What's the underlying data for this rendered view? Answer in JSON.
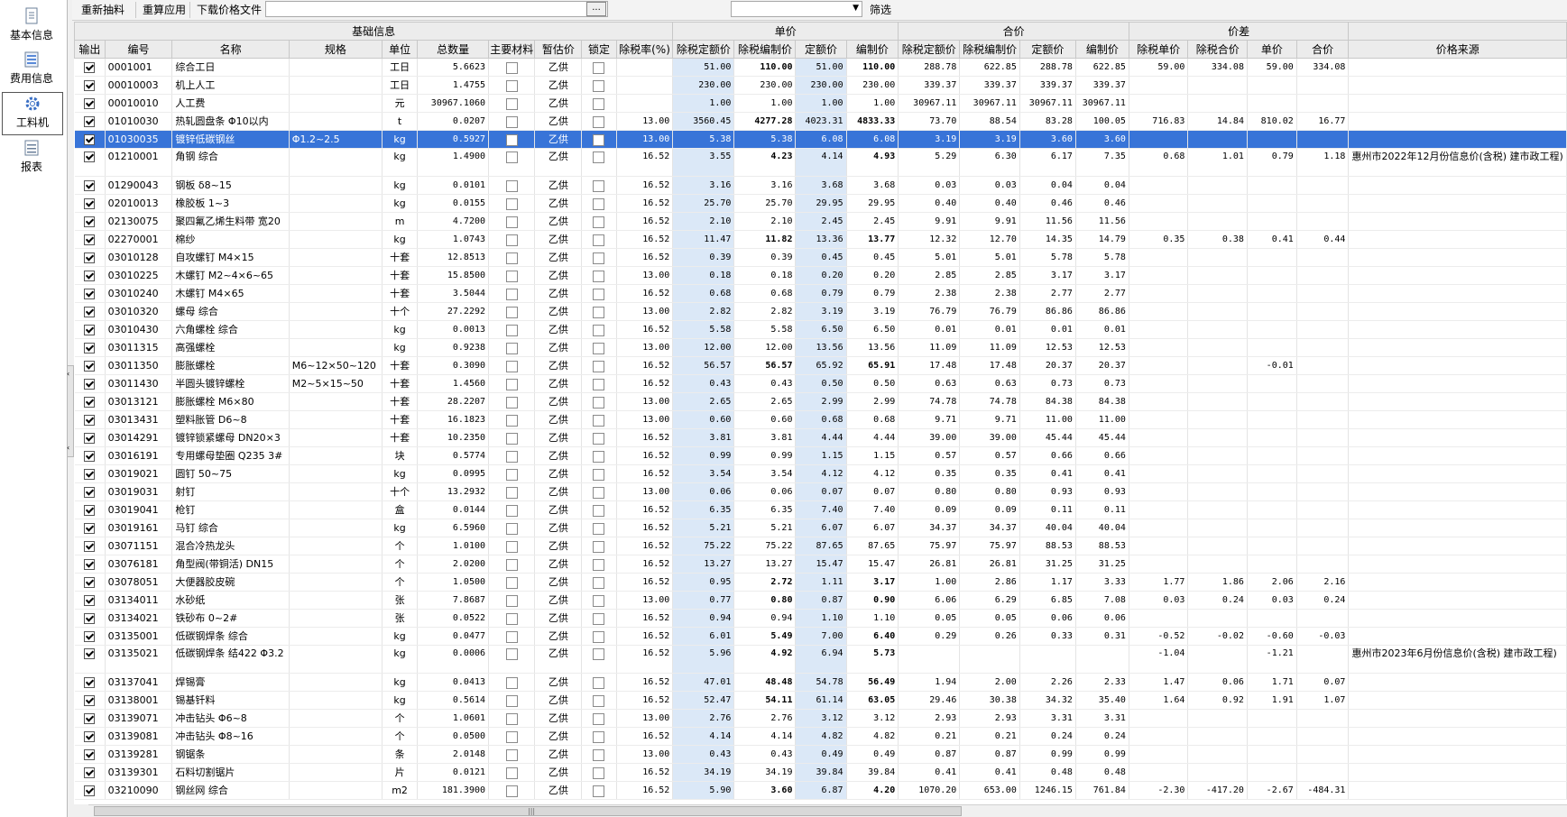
{
  "sidebar": {
    "items": [
      {
        "label": "基本信息",
        "icon": "document-icon"
      },
      {
        "label": "费用信息",
        "icon": "list-icon"
      },
      {
        "label": "工料机",
        "icon": "gear-icon"
      },
      {
        "label": "报表",
        "icon": "report-icon"
      }
    ],
    "active_index": 2
  },
  "toolbar": {
    "re_extract": "重新抽料",
    "re_apply": "重算应用",
    "download_price": "下载价格文件",
    "file_path": "",
    "browse": "...",
    "filter_value": "",
    "filter_label": "筛选"
  },
  "groups": [
    "基础信息",
    "单价",
    "合价",
    "价差"
  ],
  "columns": [
    "输出",
    "编号",
    "名称",
    "规格",
    "单位",
    "总数量",
    "主要材料",
    "暂估价",
    "锁定",
    "除税率(%)",
    "除税定额价",
    "除税编制价",
    "定额价",
    "编制价",
    "除税定额价",
    "除税编制价",
    "定额价",
    "编制价",
    "除税单价",
    "除税合价",
    "单价",
    "合价",
    "价格来源"
  ],
  "rows": [
    [
      "0001001",
      "综合工日",
      "",
      "工日",
      "5.6623",
      "乙供",
      "",
      "51.00",
      "110.00",
      "51.00",
      "110.00",
      "288.78",
      "622.85",
      "288.78",
      "622.85",
      "59.00",
      "334.08",
      "59.00",
      "334.08",
      ""
    ],
    [
      "00010003",
      "机上人工",
      "",
      "工日",
      "1.4755",
      "乙供",
      "",
      "230.00",
      "230.00",
      "230.00",
      "230.00",
      "339.37",
      "339.37",
      "339.37",
      "339.37",
      "",
      "",
      "",
      "",
      ""
    ],
    [
      "00010010",
      "人工费",
      "",
      "元",
      "30967.1060",
      "乙供",
      "",
      "1.00",
      "1.00",
      "1.00",
      "1.00",
      "30967.11",
      "30967.11",
      "30967.11",
      "30967.11",
      "",
      "",
      "",
      "",
      ""
    ],
    [
      "01010030",
      "热轧圆盘条 Φ10以内",
      "",
      "t",
      "0.0207",
      "乙供",
      "13.00",
      "3560.45",
      "4277.28",
      "4023.31",
      "4833.33",
      "73.70",
      "88.54",
      "83.28",
      "100.05",
      "716.83",
      "14.84",
      "810.02",
      "16.77",
      ""
    ],
    [
      "01030035",
      "镀锌低碳钢丝",
      "Φ1.2~2.5",
      "kg",
      "0.5927",
      "乙供",
      "13.00",
      "5.38",
      "5.38",
      "6.08",
      "6.08",
      "3.19",
      "3.19",
      "3.60",
      "3.60",
      "",
      "",
      "",
      "",
      ""
    ],
    [
      "01210001",
      "角钢 综合",
      "",
      "kg",
      "1.4900",
      "乙供",
      "16.52",
      "3.55",
      "4.23",
      "4.14",
      "4.93",
      "5.29",
      "6.30",
      "6.17",
      "7.35",
      "0.68",
      "1.01",
      "0.79",
      "1.18",
      "惠州市2022年12月份信息价(含税) 建市政工程)"
    ],
    [
      "01290043",
      "钢板 δ8~15",
      "",
      "kg",
      "0.0101",
      "乙供",
      "16.52",
      "3.16",
      "3.16",
      "3.68",
      "3.68",
      "0.03",
      "0.03",
      "0.04",
      "0.04",
      "",
      "",
      "",
      "",
      ""
    ],
    [
      "02010013",
      "橡胶板 1~3",
      "",
      "kg",
      "0.0155",
      "乙供",
      "16.52",
      "25.70",
      "25.70",
      "29.95",
      "29.95",
      "0.40",
      "0.40",
      "0.46",
      "0.46",
      "",
      "",
      "",
      "",
      ""
    ],
    [
      "02130075",
      "聚四氟乙烯生料带 宽20",
      "",
      "m",
      "4.7200",
      "乙供",
      "16.52",
      "2.10",
      "2.10",
      "2.45",
      "2.45",
      "9.91",
      "9.91",
      "11.56",
      "11.56",
      "",
      "",
      "",
      "",
      ""
    ],
    [
      "02270001",
      "棉纱",
      "",
      "kg",
      "1.0743",
      "乙供",
      "16.52",
      "11.47",
      "11.82",
      "13.36",
      "13.77",
      "12.32",
      "12.70",
      "14.35",
      "14.79",
      "0.35",
      "0.38",
      "0.41",
      "0.44",
      ""
    ],
    [
      "03010128",
      "自攻螺钉 M4×15",
      "",
      "十套",
      "12.8513",
      "乙供",
      "16.52",
      "0.39",
      "0.39",
      "0.45",
      "0.45",
      "5.01",
      "5.01",
      "5.78",
      "5.78",
      "",
      "",
      "",
      "",
      ""
    ],
    [
      "03010225",
      "木螺钉 M2~4×6~65",
      "",
      "十套",
      "15.8500",
      "乙供",
      "13.00",
      "0.18",
      "0.18",
      "0.20",
      "0.20",
      "2.85",
      "2.85",
      "3.17",
      "3.17",
      "",
      "",
      "",
      "",
      ""
    ],
    [
      "03010240",
      "木螺钉 M4×65",
      "",
      "十套",
      "3.5044",
      "乙供",
      "16.52",
      "0.68",
      "0.68",
      "0.79",
      "0.79",
      "2.38",
      "2.38",
      "2.77",
      "2.77",
      "",
      "",
      "",
      "",
      ""
    ],
    [
      "03010320",
      "螺母 综合",
      "",
      "十个",
      "27.2292",
      "乙供",
      "13.00",
      "2.82",
      "2.82",
      "3.19",
      "3.19",
      "76.79",
      "76.79",
      "86.86",
      "86.86",
      "",
      "",
      "",
      "",
      ""
    ],
    [
      "03010430",
      "六角螺栓 综合",
      "",
      "kg",
      "0.0013",
      "乙供",
      "16.52",
      "5.58",
      "5.58",
      "6.50",
      "6.50",
      "0.01",
      "0.01",
      "0.01",
      "0.01",
      "",
      "",
      "",
      "",
      ""
    ],
    [
      "03011315",
      "高强螺栓",
      "",
      "kg",
      "0.9238",
      "乙供",
      "13.00",
      "12.00",
      "12.00",
      "13.56",
      "13.56",
      "11.09",
      "11.09",
      "12.53",
      "12.53",
      "",
      "",
      "",
      "",
      ""
    ],
    [
      "03011350",
      "膨胀螺栓",
      "M6~12×50~120",
      "十套",
      "0.3090",
      "乙供",
      "16.52",
      "56.57",
      "56.57",
      "65.92",
      "65.91",
      "17.48",
      "17.48",
      "20.37",
      "20.37",
      "",
      "",
      "-0.01",
      "",
      ""
    ],
    [
      "03011430",
      "半圆头镀锌螺栓",
      "M2~5×15~50",
      "十套",
      "1.4560",
      "乙供",
      "16.52",
      "0.43",
      "0.43",
      "0.50",
      "0.50",
      "0.63",
      "0.63",
      "0.73",
      "0.73",
      "",
      "",
      "",
      "",
      ""
    ],
    [
      "03013121",
      "膨胀螺栓 M6×80",
      "",
      "十套",
      "28.2207",
      "乙供",
      "13.00",
      "2.65",
      "2.65",
      "2.99",
      "2.99",
      "74.78",
      "74.78",
      "84.38",
      "84.38",
      "",
      "",
      "",
      "",
      ""
    ],
    [
      "03013431",
      "塑料胀管 D6~8",
      "",
      "十套",
      "16.1823",
      "乙供",
      "13.00",
      "0.60",
      "0.60",
      "0.68",
      "0.68",
      "9.71",
      "9.71",
      "11.00",
      "11.00",
      "",
      "",
      "",
      "",
      ""
    ],
    [
      "03014291",
      "镀锌锁紧螺母 DN20×3",
      "",
      "十套",
      "10.2350",
      "乙供",
      "16.52",
      "3.81",
      "3.81",
      "4.44",
      "4.44",
      "39.00",
      "39.00",
      "45.44",
      "45.44",
      "",
      "",
      "",
      "",
      ""
    ],
    [
      "03016191",
      "专用螺母垫圈 Q235 3#",
      "",
      "块",
      "0.5774",
      "乙供",
      "16.52",
      "0.99",
      "0.99",
      "1.15",
      "1.15",
      "0.57",
      "0.57",
      "0.66",
      "0.66",
      "",
      "",
      "",
      "",
      ""
    ],
    [
      "03019021",
      "圆钉 50~75",
      "",
      "kg",
      "0.0995",
      "乙供",
      "16.52",
      "3.54",
      "3.54",
      "4.12",
      "4.12",
      "0.35",
      "0.35",
      "0.41",
      "0.41",
      "",
      "",
      "",
      "",
      ""
    ],
    [
      "03019031",
      "射钉",
      "",
      "十个",
      "13.2932",
      "乙供",
      "13.00",
      "0.06",
      "0.06",
      "0.07",
      "0.07",
      "0.80",
      "0.80",
      "0.93",
      "0.93",
      "",
      "",
      "",
      "",
      ""
    ],
    [
      "03019041",
      "枪钉",
      "",
      "盒",
      "0.0144",
      "乙供",
      "16.52",
      "6.35",
      "6.35",
      "7.40",
      "7.40",
      "0.09",
      "0.09",
      "0.11",
      "0.11",
      "",
      "",
      "",
      "",
      ""
    ],
    [
      "03019161",
      "马钉 综合",
      "",
      "kg",
      "6.5960",
      "乙供",
      "16.52",
      "5.21",
      "5.21",
      "6.07",
      "6.07",
      "34.37",
      "34.37",
      "40.04",
      "40.04",
      "",
      "",
      "",
      "",
      ""
    ],
    [
      "03071151",
      "混合冷热龙头",
      "",
      "个",
      "1.0100",
      "乙供",
      "16.52",
      "75.22",
      "75.22",
      "87.65",
      "87.65",
      "75.97",
      "75.97",
      "88.53",
      "88.53",
      "",
      "",
      "",
      "",
      ""
    ],
    [
      "03076181",
      "角型阀(带铜活) DN15",
      "",
      "个",
      "2.0200",
      "乙供",
      "16.52",
      "13.27",
      "13.27",
      "15.47",
      "15.47",
      "26.81",
      "26.81",
      "31.25",
      "31.25",
      "",
      "",
      "",
      "",
      ""
    ],
    [
      "03078051",
      "大便器胶皮碗",
      "",
      "个",
      "1.0500",
      "乙供",
      "16.52",
      "0.95",
      "2.72",
      "1.11",
      "3.17",
      "1.00",
      "2.86",
      "1.17",
      "3.33",
      "1.77",
      "1.86",
      "2.06",
      "2.16",
      ""
    ],
    [
      "03134011",
      "水砂纸",
      "",
      "张",
      "7.8687",
      "乙供",
      "13.00",
      "0.77",
      "0.80",
      "0.87",
      "0.90",
      "6.06",
      "6.29",
      "6.85",
      "7.08",
      "0.03",
      "0.24",
      "0.03",
      "0.24",
      ""
    ],
    [
      "03134021",
      "铁砂布 0~2#",
      "",
      "张",
      "0.0522",
      "乙供",
      "16.52",
      "0.94",
      "0.94",
      "1.10",
      "1.10",
      "0.05",
      "0.05",
      "0.06",
      "0.06",
      "",
      "",
      "",
      "",
      ""
    ],
    [
      "03135001",
      "低碳钢焊条 综合",
      "",
      "kg",
      "0.0477",
      "乙供",
      "16.52",
      "6.01",
      "5.49",
      "7.00",
      "6.40",
      "0.29",
      "0.26",
      "0.33",
      "0.31",
      "-0.52",
      "-0.02",
      "-0.60",
      "-0.03",
      ""
    ],
    [
      "03135021",
      "低碳钢焊条 结422 Φ3.2",
      "",
      "kg",
      "0.0006",
      "乙供",
      "16.52",
      "5.96",
      "4.92",
      "6.94",
      "5.73",
      "",
      "",
      "",
      "",
      "-1.04",
      "",
      "-1.21",
      "",
      "惠州市2023年6月份信息价(含税) 建市政工程)"
    ],
    [
      "03137041",
      "焊锡膏",
      "",
      "kg",
      "0.0413",
      "乙供",
      "16.52",
      "47.01",
      "48.48",
      "54.78",
      "56.49",
      "1.94",
      "2.00",
      "2.26",
      "2.33",
      "1.47",
      "0.06",
      "1.71",
      "0.07",
      ""
    ],
    [
      "03138001",
      "锡基钎料",
      "",
      "kg",
      "0.5614",
      "乙供",
      "16.52",
      "52.47",
      "54.11",
      "61.14",
      "63.05",
      "29.46",
      "30.38",
      "34.32",
      "35.40",
      "1.64",
      "0.92",
      "1.91",
      "1.07",
      ""
    ],
    [
      "03139071",
      "冲击钻头 Φ6~8",
      "",
      "个",
      "1.0601",
      "乙供",
      "13.00",
      "2.76",
      "2.76",
      "3.12",
      "3.12",
      "2.93",
      "2.93",
      "3.31",
      "3.31",
      "",
      "",
      "",
      "",
      ""
    ],
    [
      "03139081",
      "冲击钻头 Φ8~16",
      "",
      "个",
      "0.0500",
      "乙供",
      "16.52",
      "4.14",
      "4.14",
      "4.82",
      "4.82",
      "0.21",
      "0.21",
      "0.24",
      "0.24",
      "",
      "",
      "",
      "",
      ""
    ],
    [
      "03139281",
      "钢锯条",
      "",
      "条",
      "2.0148",
      "乙供",
      "13.00",
      "0.43",
      "0.43",
      "0.49",
      "0.49",
      "0.87",
      "0.87",
      "0.99",
      "0.99",
      "",
      "",
      "",
      "",
      ""
    ],
    [
      "03139301",
      "石料切割锯片",
      "",
      "片",
      "0.0121",
      "乙供",
      "16.52",
      "34.19",
      "34.19",
      "39.84",
      "39.84",
      "0.41",
      "0.41",
      "0.48",
      "0.48",
      "",
      "",
      "",
      "",
      ""
    ],
    [
      "03210090",
      "钢丝网 综合",
      "",
      "m2",
      "181.3900",
      "乙供",
      "16.52",
      "5.90",
      "3.60",
      "6.87",
      "4.20",
      "1070.20",
      "653.00",
      "1246.15",
      "761.84",
      "-2.30",
      "-417.20",
      "-2.67",
      "-484.31",
      ""
    ]
  ],
  "selected_row": 4,
  "bold_cols": [
    8,
    10
  ],
  "bold_rows_in_cols": [
    0,
    3,
    5,
    9,
    16,
    28,
    29,
    31,
    32,
    33,
    34,
    39
  ]
}
